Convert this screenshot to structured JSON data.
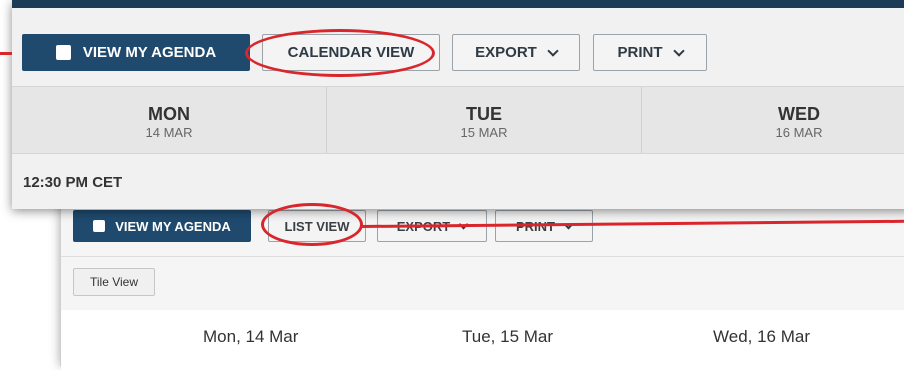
{
  "colors": {
    "primary": "#1f4a6e",
    "top_bar": "#1c3b57",
    "annotation": "#d9262c"
  },
  "back_panel": {
    "toolbar": {
      "agenda_label": "VIEW MY AGENDA",
      "list_view_label": "LIST VIEW",
      "export_label": "EXPORT",
      "print_label": "PRINT"
    },
    "tile_view_label": "Tile View",
    "days": [
      "Mon, 14 Mar",
      "Tue, 15 Mar",
      "Wed, 16 Mar"
    ]
  },
  "front_panel": {
    "toolbar": {
      "agenda_label": "VIEW MY AGENDA",
      "calendar_view_label": "CALENDAR VIEW",
      "export_label": "EXPORT",
      "print_label": "PRINT"
    },
    "days": [
      {
        "name": "MON",
        "date": "14 MAR"
      },
      {
        "name": "TUE",
        "date": "15 MAR"
      },
      {
        "name": "WED",
        "date": "16 MAR"
      }
    ],
    "time_slot": "12:30 PM CET"
  }
}
